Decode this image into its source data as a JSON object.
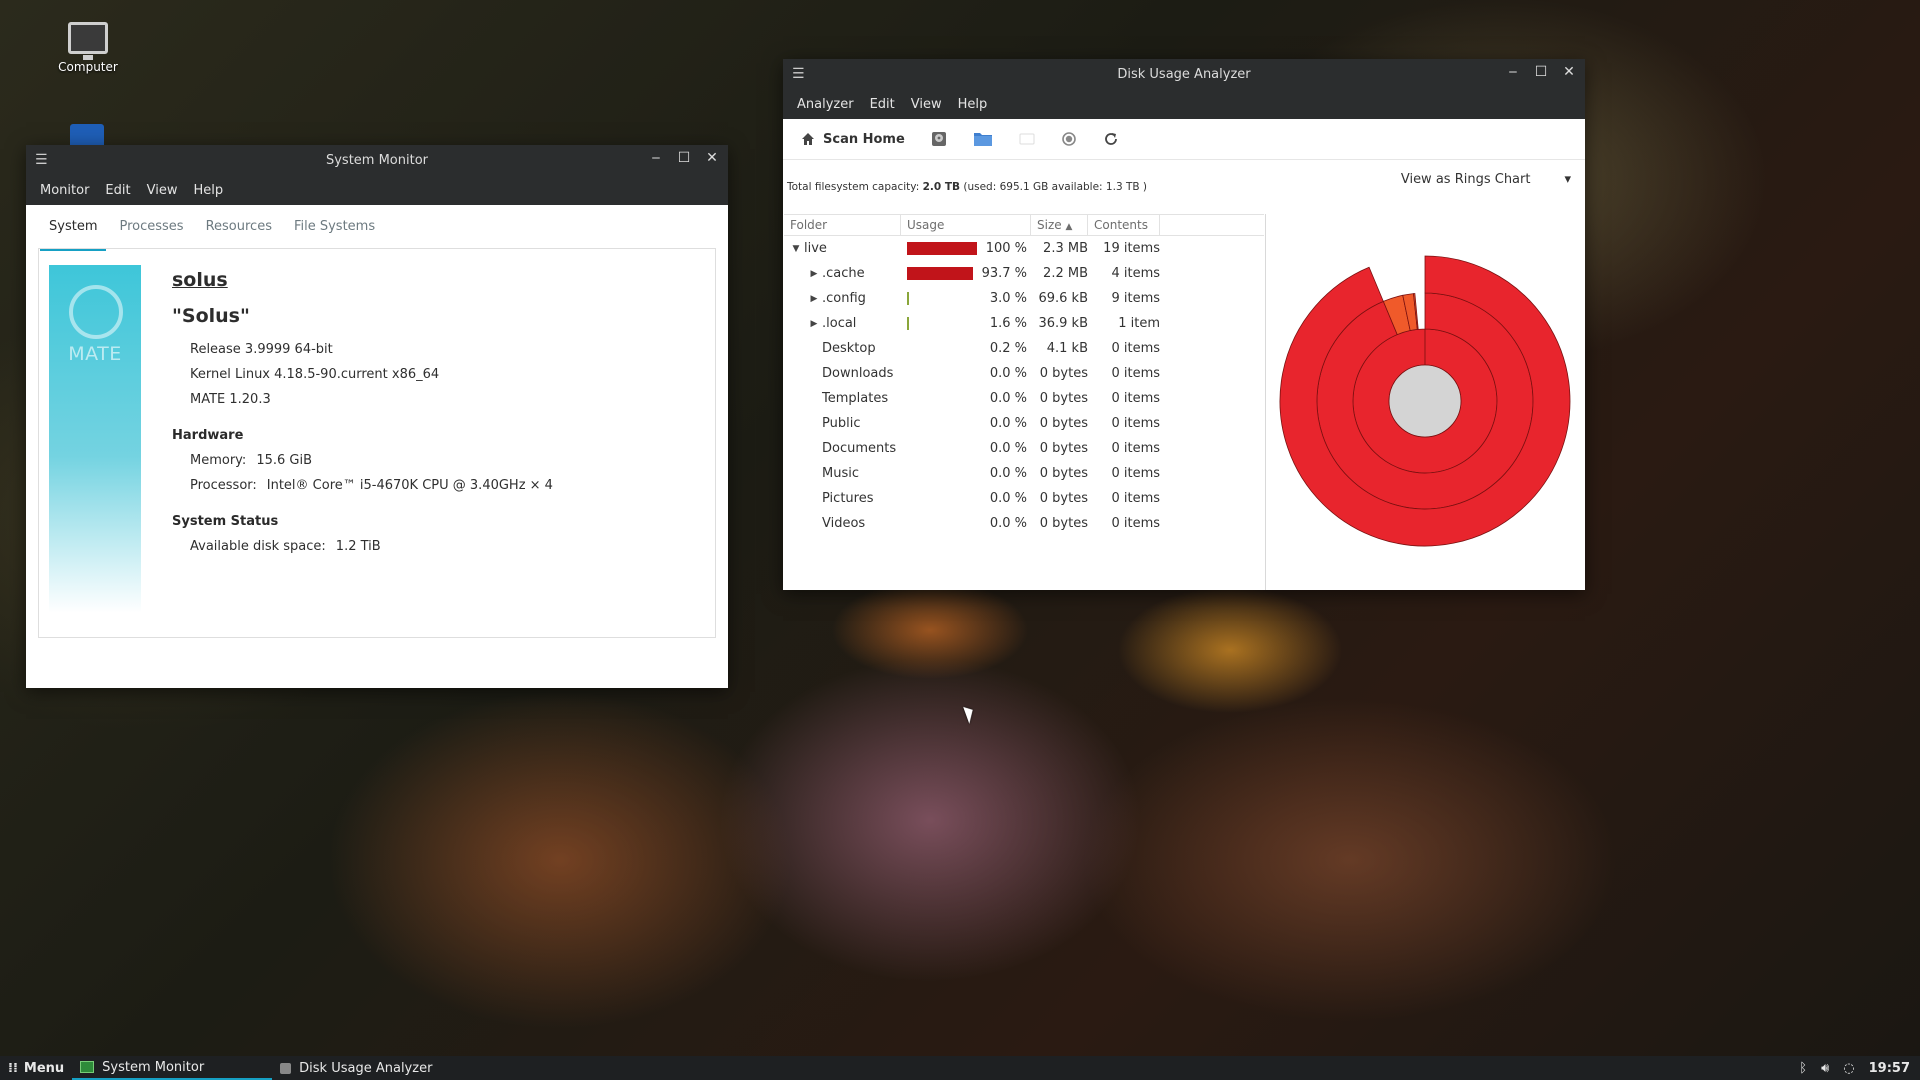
{
  "desktop": {
    "icons": [
      {
        "label": "Computer",
        "icon": "computer-icon"
      }
    ]
  },
  "system_monitor": {
    "title": "System Monitor",
    "menu": [
      "Monitor",
      "Edit",
      "View",
      "Help"
    ],
    "tabs": [
      "System",
      "Processes",
      "Resources",
      "File Systems"
    ],
    "active_tab": "System",
    "logo_text": "MATE",
    "hostname": "solus",
    "distro": "\"Solus\"",
    "release": "Release 3.9999 64-bit",
    "kernel": "Kernel Linux 4.18.5-90.current x86_64",
    "mate_version": "MATE 1.20.3",
    "hardware": {
      "heading": "Hardware",
      "memory_label": "Memory:",
      "memory_value": "15.6 GiB",
      "processor_label": "Processor:",
      "processor_value": "Intel® Core™ i5-4670K CPU @ 3.40GHz × 4"
    },
    "status": {
      "heading": "System Status",
      "disk_label": "Available disk space:",
      "disk_value": "1.2 TiB"
    }
  },
  "disk_usage_analyzer": {
    "title": "Disk Usage Analyzer",
    "menu": [
      "Analyzer",
      "Edit",
      "View",
      "Help"
    ],
    "toolbar": {
      "scan_home": "Scan Home"
    },
    "capacity": {
      "prefix": "Total filesystem capacity:",
      "total": "2.0 TB",
      "detail": "(used: 695.1 GB available: 1.3 TB )"
    },
    "view_mode": "View as Rings Chart",
    "columns": {
      "folder": "Folder",
      "usage": "Usage",
      "size": "Size",
      "contents": "Contents"
    },
    "rows": [
      {
        "name": "live",
        "expander": "expanded",
        "indent": 0,
        "usage_pct": 100,
        "pct": "100 %",
        "size": "2.3 MB",
        "contents": "19 items"
      },
      {
        "name": ".cache",
        "expander": "collapsed",
        "indent": 1,
        "usage_pct": 93.7,
        "pct": "93.7 %",
        "size": "2.2 MB",
        "contents": "4 items"
      },
      {
        "name": ".config",
        "expander": "collapsed",
        "indent": 1,
        "usage_pct": 3.0,
        "pct": "3.0 %",
        "size": "69.6 kB",
        "contents": "9 items"
      },
      {
        "name": ".local",
        "expander": "collapsed",
        "indent": 1,
        "usage_pct": 1.6,
        "pct": "1.6 %",
        "size": "36.9 kB",
        "contents": "1 item"
      },
      {
        "name": "Desktop",
        "expander": "none",
        "indent": 1,
        "usage_pct": 0.2,
        "pct": "0.2 %",
        "size": "4.1 kB",
        "contents": "0 items"
      },
      {
        "name": "Downloads",
        "expander": "none",
        "indent": 1,
        "usage_pct": 0.0,
        "pct": "0.0 %",
        "size": "0 bytes",
        "contents": "0 items"
      },
      {
        "name": "Templates",
        "expander": "none",
        "indent": 1,
        "usage_pct": 0.0,
        "pct": "0.0 %",
        "size": "0 bytes",
        "contents": "0 items"
      },
      {
        "name": "Public",
        "expander": "none",
        "indent": 1,
        "usage_pct": 0.0,
        "pct": "0.0 %",
        "size": "0 bytes",
        "contents": "0 items"
      },
      {
        "name": "Documents",
        "expander": "none",
        "indent": 1,
        "usage_pct": 0.0,
        "pct": "0.0 %",
        "size": "0 bytes",
        "contents": "0 items"
      },
      {
        "name": "Music",
        "expander": "none",
        "indent": 1,
        "usage_pct": 0.0,
        "pct": "0.0 %",
        "size": "0 bytes",
        "contents": "0 items"
      },
      {
        "name": "Pictures",
        "expander": "none",
        "indent": 1,
        "usage_pct": 0.0,
        "pct": "0.0 %",
        "size": "0 bytes",
        "contents": "0 items"
      },
      {
        "name": "Videos",
        "expander": "none",
        "indent": 1,
        "usage_pct": 0.0,
        "pct": "0.0 %",
        "size": "0 bytes",
        "contents": "0 items"
      }
    ],
    "colors": {
      "bar": "#c1141a",
      "ring": "#e8252d",
      "ring_accent": "#f05a2a",
      "center": "#d4d4d4"
    }
  },
  "taskbar": {
    "menu_label": "Menu",
    "tasks": [
      {
        "label": "System Monitor",
        "active": true
      },
      {
        "label": "Disk Usage Analyzer",
        "active": false
      }
    ],
    "clock": "19:57"
  }
}
